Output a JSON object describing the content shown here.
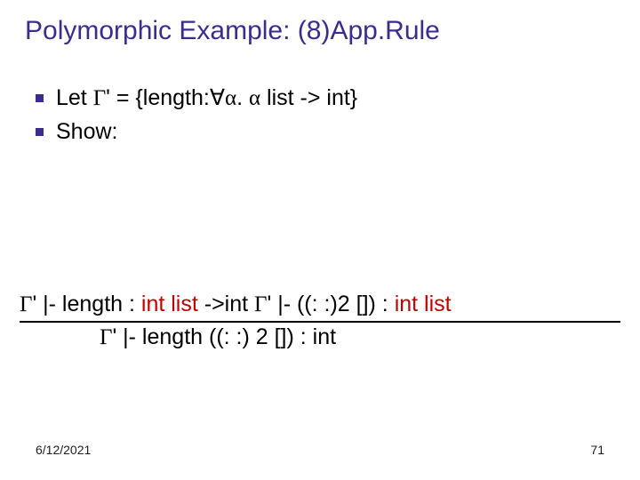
{
  "slide": {
    "title": "Polymorphic Example: (8)App.Rule",
    "bullets": {
      "b1": {
        "p1": "Let ",
        "gamma": "Γ",
        "p2": "' = {length:",
        "forall": "∀",
        "alpha1": "α",
        "p3": ". ",
        "alpha2": "α",
        "p4": " list -> int}"
      },
      "b2": "Show:"
    },
    "rule": {
      "prem_g1": "Γ",
      "prem_t1": "' |- length : ",
      "prem_red1": "int list ",
      "prem_t1b": "->int   ",
      "prem_g2": "Γ",
      "prem_t2": "' |- ((: :)2 []) : ",
      "prem_red2": "int list ",
      "conc_g": "Γ",
      "conc_t": "' |- length ((: :) 2 []) : int"
    },
    "footer": {
      "date": "6/12/2021",
      "page": "71"
    }
  }
}
